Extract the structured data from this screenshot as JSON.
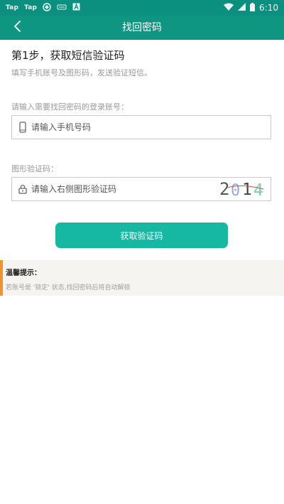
{
  "status_bar": {
    "app1": "Tap",
    "app2": "Tap",
    "time": "6:10"
  },
  "header": {
    "title": "找回密码",
    "back_icon": "chevron-left-icon"
  },
  "step": {
    "title": "第1步，获取短信验证码",
    "description": "填写手机账号及图形码，发送验证短信。"
  },
  "account": {
    "label": "请输入需要找回密码的登录账号：",
    "placeholder": "请输入手机号码",
    "icon": "phone-icon"
  },
  "captcha": {
    "label": "图形验证码：",
    "placeholder": "请输入右侧图形验证码",
    "icon": "lock-icon",
    "code": "2014",
    "digit_colors": [
      "#4b5a4b",
      "#9aa8d6",
      "#3d4a3a",
      "#7fd0b0"
    ]
  },
  "submit": {
    "label": "获取验证码"
  },
  "tips": {
    "title": "温馨提示：",
    "text": "若账号是 '锁定' 状态,找回密码后将自动解锁"
  },
  "colors": {
    "primary": "#0e9682",
    "button": "#16b8a2",
    "tip_accent": "#f0922e"
  }
}
